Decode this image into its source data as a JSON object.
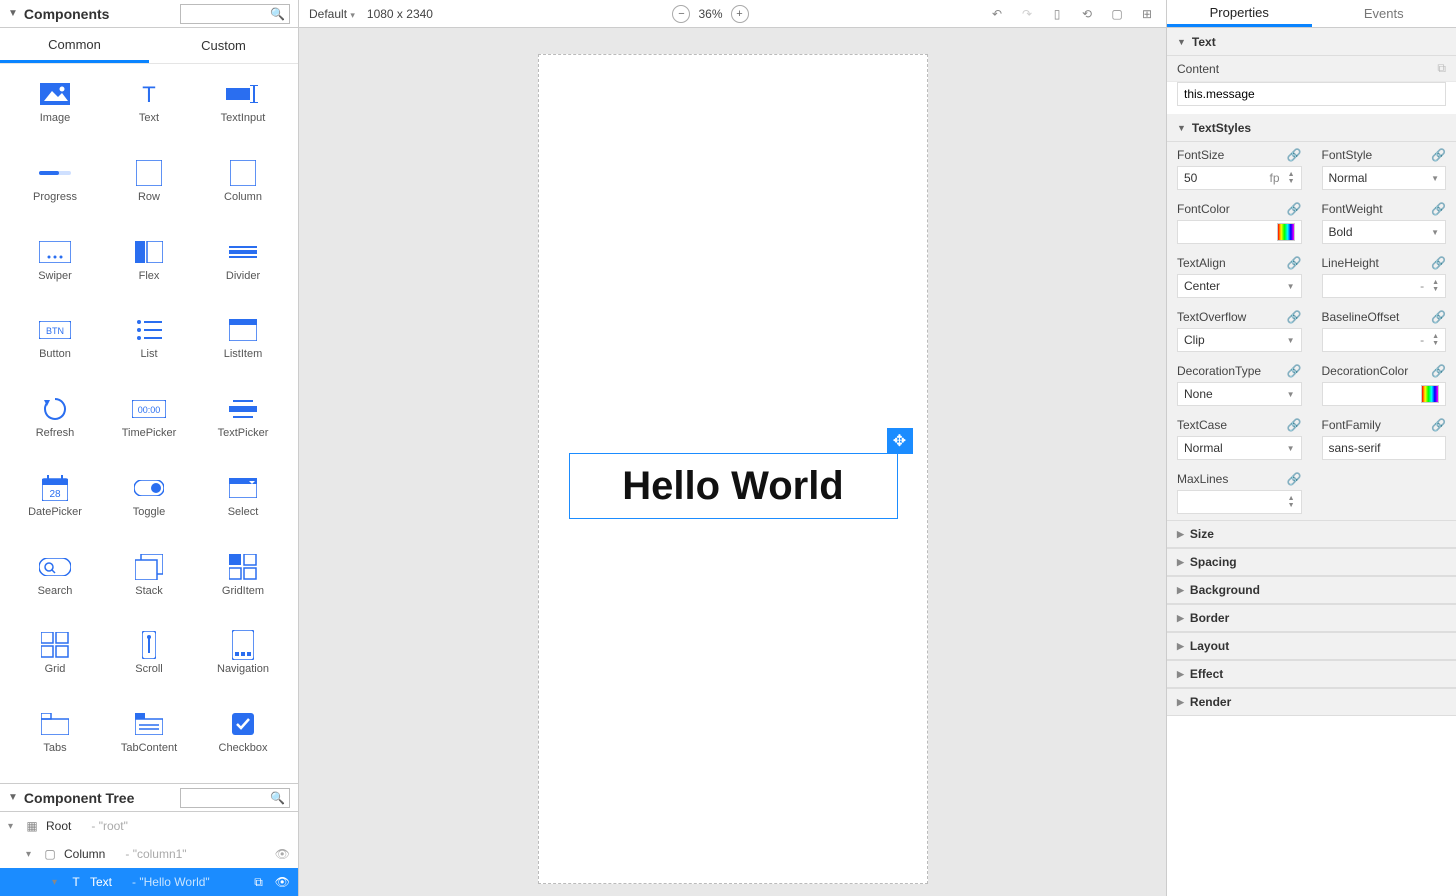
{
  "leftPanel": {
    "title": "Components",
    "tabs": {
      "common": "Common",
      "custom": "Custom",
      "active": "common"
    },
    "items": [
      "Image",
      "Text",
      "TextInput",
      "Progress",
      "Row",
      "Column",
      "Swiper",
      "Flex",
      "Divider",
      "Button",
      "List",
      "ListItem",
      "Refresh",
      "TimePicker",
      "TextPicker",
      "DatePicker",
      "Toggle",
      "Select",
      "Search",
      "Stack",
      "GridItem",
      "Grid",
      "Scroll",
      "Navigation",
      "Tabs",
      "TabContent",
      "Checkbox"
    ]
  },
  "treePanel": {
    "title": "Component Tree",
    "rows": [
      {
        "name": "Root",
        "value": "- \"root\"",
        "indent": 0,
        "icon": "root"
      },
      {
        "name": "Column",
        "value": "- \"column1\"",
        "indent": 1,
        "icon": "column",
        "eye": true
      },
      {
        "name": "Text",
        "value": "- \"Hello World\"",
        "indent": 2,
        "icon": "text",
        "selected": true,
        "extra": true
      }
    ]
  },
  "toolbar": {
    "mode": "Default",
    "dimensions": "1080 x 2340",
    "zoom": "36%"
  },
  "canvas": {
    "text": "Hello World"
  },
  "rightPanel": {
    "tabs": {
      "properties": "Properties",
      "events": "Events",
      "active": "properties"
    },
    "sections": {
      "text": {
        "title": "Text",
        "contentLabel": "Content",
        "contentValue": "this.message"
      },
      "textStyles": {
        "title": "TextStyles",
        "fontSize": {
          "label": "FontSize",
          "value": "50",
          "unit": "fp"
        },
        "fontStyle": {
          "label": "FontStyle",
          "value": "Normal"
        },
        "fontColor": {
          "label": "FontColor"
        },
        "fontWeight": {
          "label": "FontWeight",
          "value": "Bold"
        },
        "textAlign": {
          "label": "TextAlign",
          "value": "Center"
        },
        "lineHeight": {
          "label": "LineHeight",
          "value": "-"
        },
        "textOverflow": {
          "label": "TextOverflow",
          "value": "Clip"
        },
        "baselineOffset": {
          "label": "BaselineOffset",
          "value": "-"
        },
        "decorationType": {
          "label": "DecorationType",
          "value": "None"
        },
        "decorationColor": {
          "label": "DecorationColor"
        },
        "textCase": {
          "label": "TextCase",
          "value": "Normal"
        },
        "fontFamily": {
          "label": "FontFamily",
          "value": "sans-serif"
        },
        "maxLines": {
          "label": "MaxLines",
          "value": ""
        }
      },
      "collapsed": [
        "Size",
        "Spacing",
        "Background",
        "Border",
        "Layout",
        "Effect",
        "Render"
      ]
    }
  }
}
